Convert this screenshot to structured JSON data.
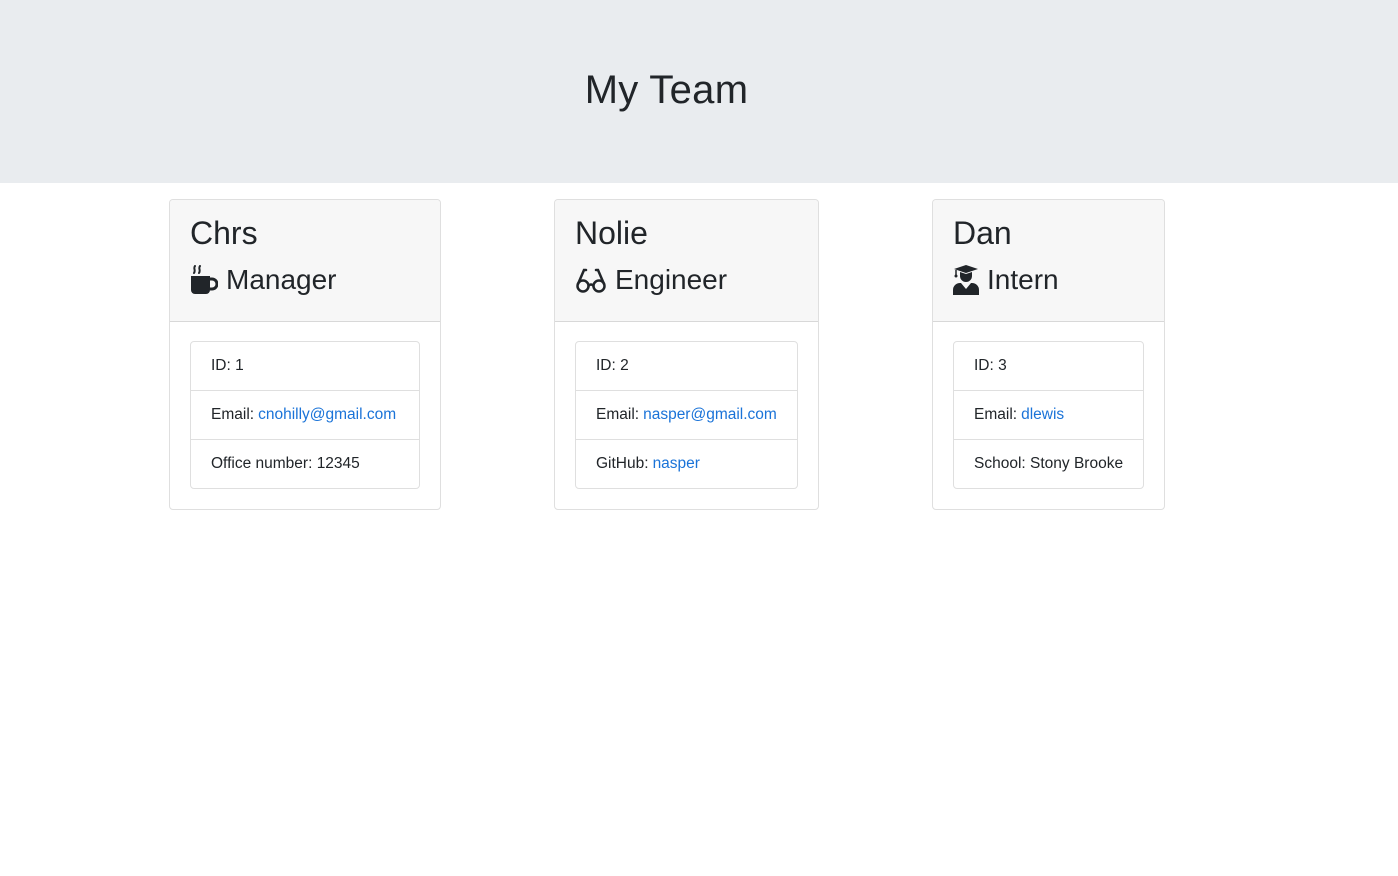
{
  "header": {
    "title": "My Team"
  },
  "colors": {
    "jumbotron": "#e9ecef",
    "card_header": "#f7f7f7",
    "link": "#1a73d8",
    "text": "#212529"
  },
  "cards": [
    {
      "name": "Chrs",
      "role": "Manager",
      "icon": "mug-hot-icon",
      "id_label": "ID:",
      "id_value": "1",
      "email_label": "Email:",
      "email": "cnohilly@gmail.com",
      "extra_label": "Office number:",
      "extra_value": "12345"
    },
    {
      "name": "Nolie",
      "role": "Engineer",
      "icon": "glasses-icon",
      "id_label": "ID:",
      "id_value": "2",
      "email_label": "Email:",
      "email": "nasper@gmail.com",
      "extra_label": "GitHub:",
      "extra_value": "nasper"
    },
    {
      "name": "Dan",
      "role": "Intern",
      "icon": "user-graduate-icon",
      "id_label": "ID:",
      "id_value": "3",
      "email_label": "Email:",
      "email": "dlewis",
      "extra_label": "School:",
      "extra_value": "Stony Brooke"
    }
  ]
}
